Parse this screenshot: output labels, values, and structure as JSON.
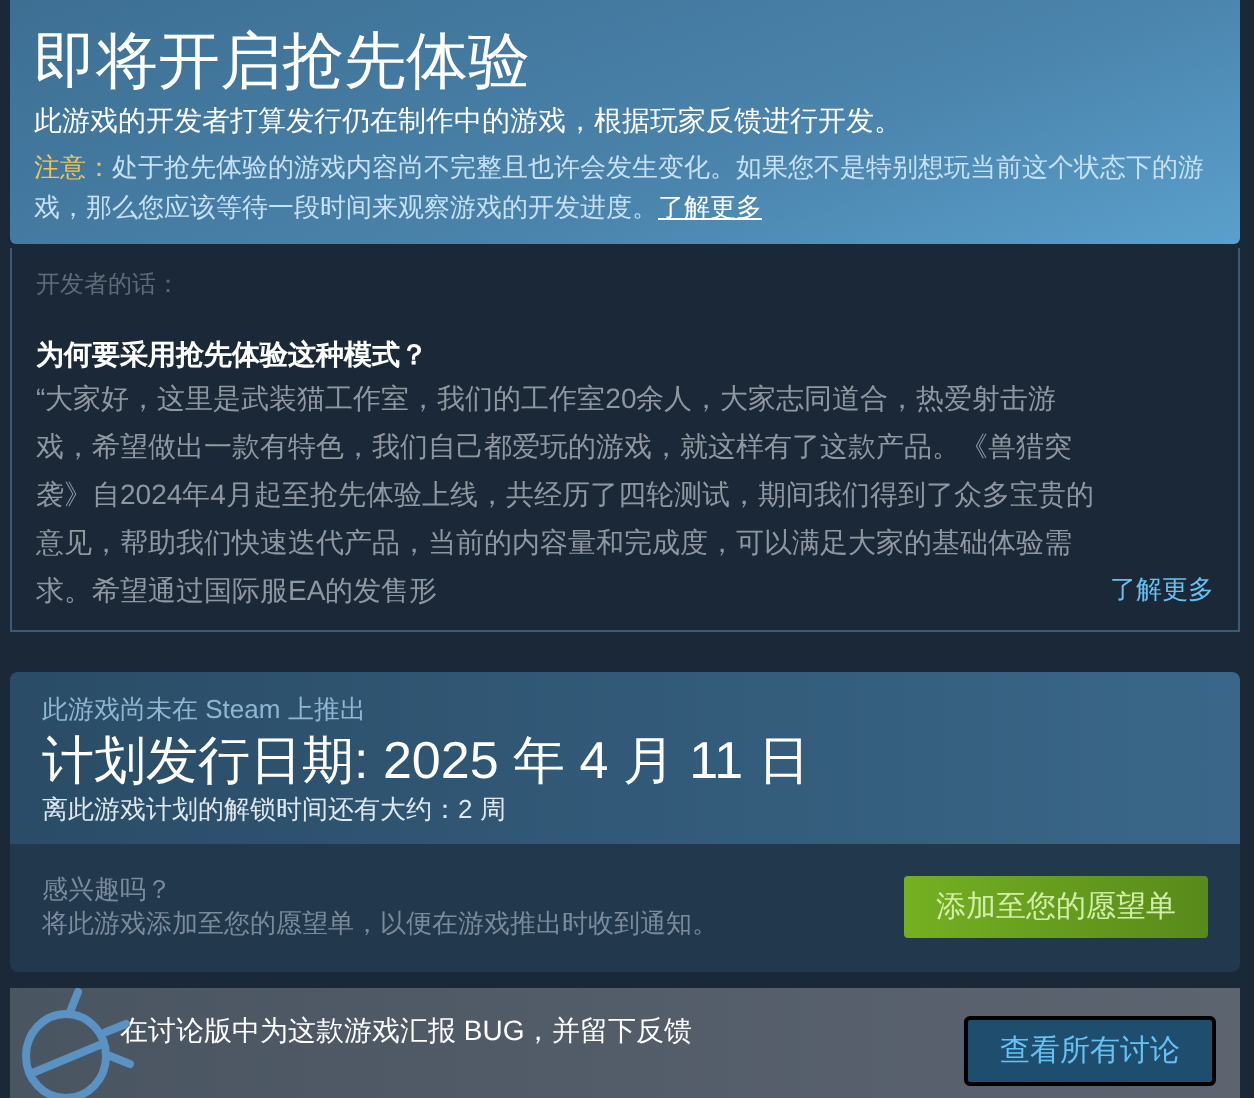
{
  "early_access": {
    "title": "即将开启抢先体验",
    "subtitle": "此游戏的开发者打算发行仍在制作中的游戏，根据玩家反馈进行开发。",
    "notice_label": "注意：",
    "notice": "处于抢先体验的游戏内容尚不完整且也许会发生变化。如果您不是特别想玩当前这个状态下的游戏，那么您应该等待一段时间来观察游戏的开发进度。",
    "notice_link": "了解更多"
  },
  "developer_note": {
    "label": "开发者的话：",
    "heading": "为何要采用抢先体验这种模式？",
    "body": "“大家好，这里是武装猫工作室，我们的工作室20余人，大家志同道合，热爱射击游戏，希望做出一款有特色，我们自己都爱玩的游戏，就这样有了这款产品。《兽猎突袭》自2024年4月起至抢先体验上线，共经历了四轮测试，期间我们得到了众多宝贵的意见，帮助我们快速迭代产品，当前的内容量和完成度，可以满足大家的基础体验需求。希望通过国际服EA的发售形",
    "more_link": "了解更多"
  },
  "release": {
    "status": "此游戏尚未在 Steam 上推出",
    "date": "计划发行日期: 2025 年 4 月 11 日",
    "countdown": "离此游戏计划的解锁时间还有大约：2 周",
    "interest": "感兴趣吗？",
    "interest_hint": "将此游戏添加至您的愿望单，以便在游戏推出时收到通知。",
    "wishlist_button": "添加至您的愿望单"
  },
  "bug_report": {
    "text": "在讨论版中为这款游戏汇报 BUG，并留下反馈",
    "button": "查看所有讨论"
  }
}
